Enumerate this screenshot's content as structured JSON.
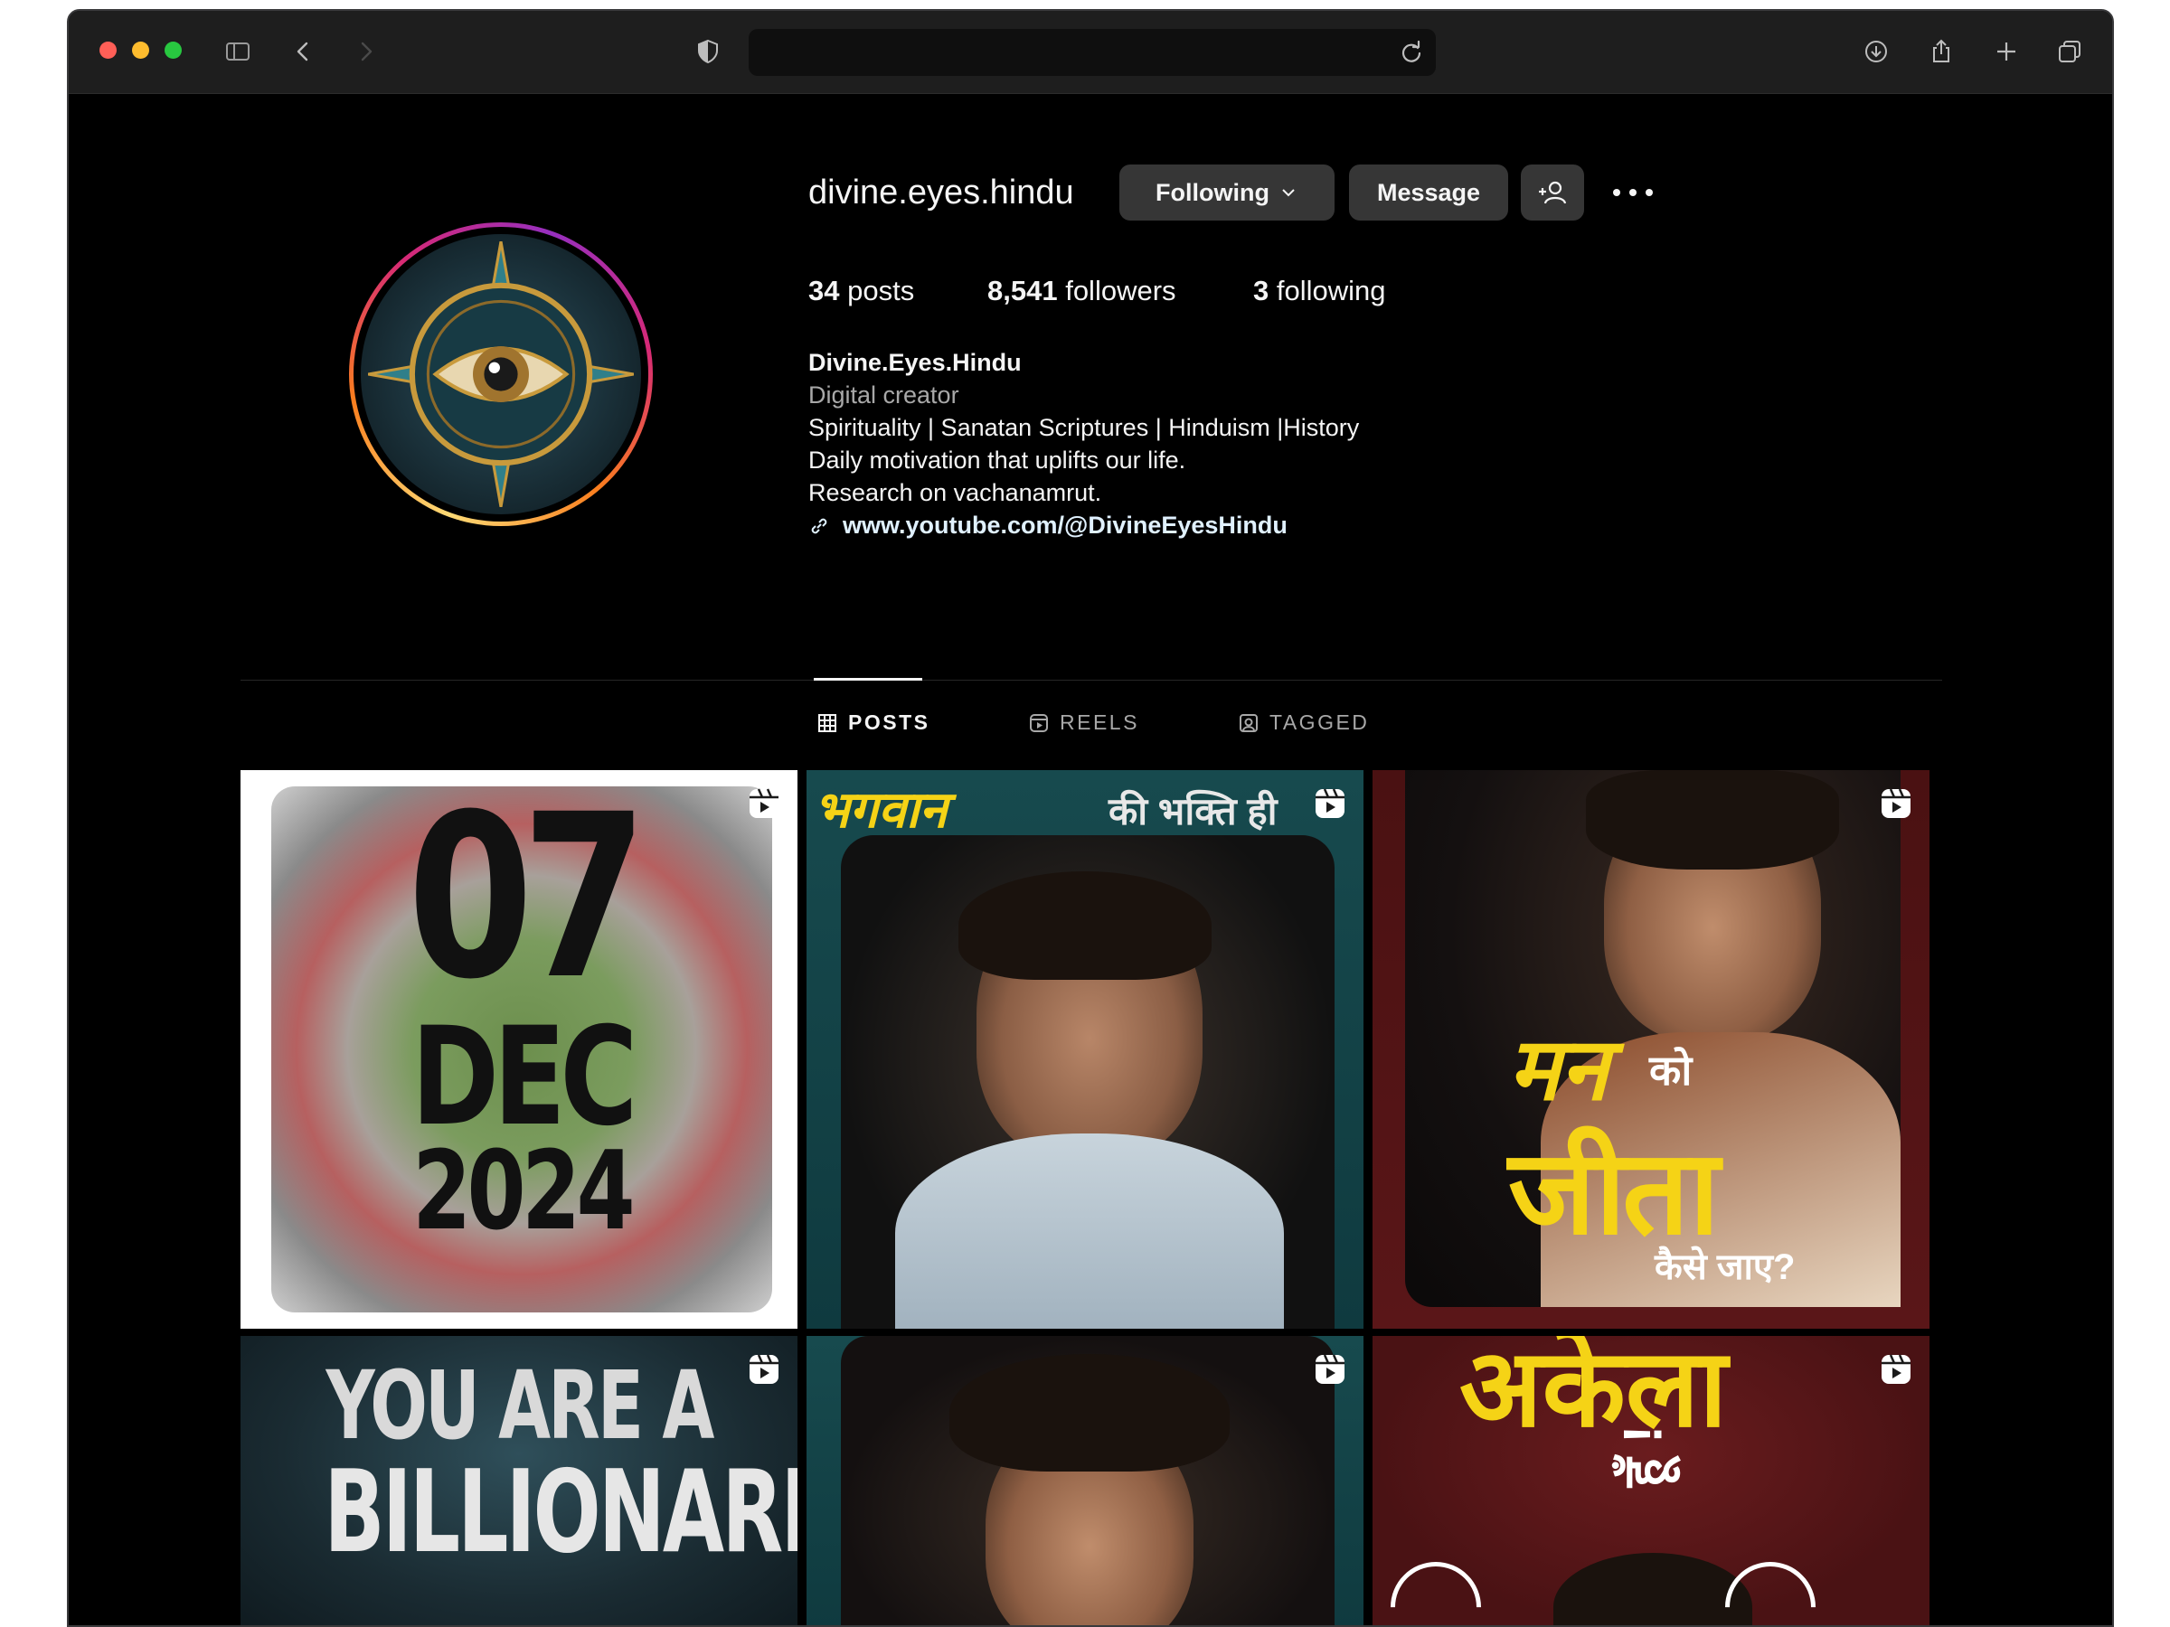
{
  "browser": {
    "traffic_colors": [
      "#ff5f57",
      "#febc2e",
      "#28c840"
    ]
  },
  "profile": {
    "username": "divine.eyes.hindu",
    "following_button": "Following",
    "message_button": "Message",
    "posts_count": "34",
    "posts_label": "posts",
    "followers_count": "8,541",
    "followers_label": "followers",
    "following_count": "3",
    "following_label": "following",
    "display_name": "Divine.Eyes.Hindu",
    "category": "Digital creator",
    "bio": [
      "Spirituality | Sanatan Scriptures | Hinduism |History",
      "Daily motivation that uplifts our life.",
      "Research on vachanamrut."
    ],
    "link": "www.youtube.com/@DivineEyesHindu"
  },
  "tabs": {
    "posts": "POSTS",
    "reels": "REELS",
    "tagged": "TAGGED"
  },
  "grid": {
    "post1": {
      "line1": "07",
      "line2": "DEC",
      "line3": "2024"
    },
    "post2": {
      "title_a": "भगवान",
      "title_b": "की भक्ति ही"
    },
    "post3": {
      "w1": "मन",
      "w2": "को",
      "w3": "जीता",
      "w4": "कैसे जाए?"
    },
    "post4": {
      "line1": "YOU ARE A",
      "line2": "BILLIONARE"
    },
    "post6": {
      "w1": "अकेला",
      "w2": "हूँ !"
    }
  },
  "colors": {
    "accent_yellow": "#f5d316",
    "button_bg": "#363636"
  }
}
